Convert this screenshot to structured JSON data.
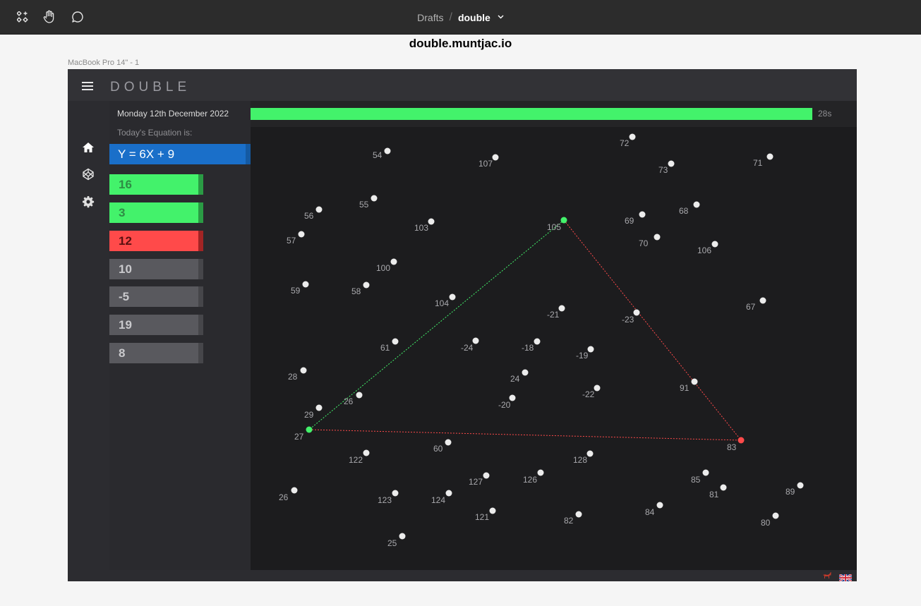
{
  "toolbar": {
    "breadcrumb_drafts": "Drafts",
    "breadcrumb_sep": "/",
    "file_name": "double"
  },
  "page_title": "double.muntjac.io",
  "frame_label": "MacBook Pro 14\" - 1",
  "app": {
    "brand": "DOUBLE",
    "date": "Monday 12th December 2022",
    "equation_label": "Today's Equation is:",
    "equation": "Y = 6X + 9",
    "answers": [
      {
        "value": "16",
        "state": "correct"
      },
      {
        "value": "3",
        "state": "correct"
      },
      {
        "value": "12",
        "state": "wrong"
      },
      {
        "value": "10",
        "state": "neutral"
      },
      {
        "value": "-5",
        "state": "neutral"
      },
      {
        "value": "19",
        "state": "neutral"
      },
      {
        "value": "8",
        "state": "neutral"
      }
    ],
    "timer": {
      "text": "28s",
      "remaining_fraction": 0.93
    },
    "colors": {
      "green": "#43f26b",
      "red": "#ff4a4a",
      "blue": "#1a6fc9"
    }
  },
  "nodes": [
    "72",
    "54",
    "107",
    "73",
    "71",
    "55",
    "56",
    "103",
    "69",
    "68",
    "105",
    "57",
    "70",
    "106",
    "100",
    "59",
    "58",
    "104",
    "-21",
    "-23",
    "67",
    "61",
    "-24",
    "-18",
    "-19",
    "28",
    "24",
    "-22",
    "91",
    "29",
    "26",
    "-20",
    "27",
    "83",
    "60",
    "122",
    "128",
    "127",
    "126",
    "85",
    "81",
    "89",
    "26",
    "123",
    "124",
    "84",
    "121",
    "82",
    "80",
    "25"
  ],
  "triangle_labels": {
    "a": "105",
    "b": "27",
    "c": "83"
  }
}
